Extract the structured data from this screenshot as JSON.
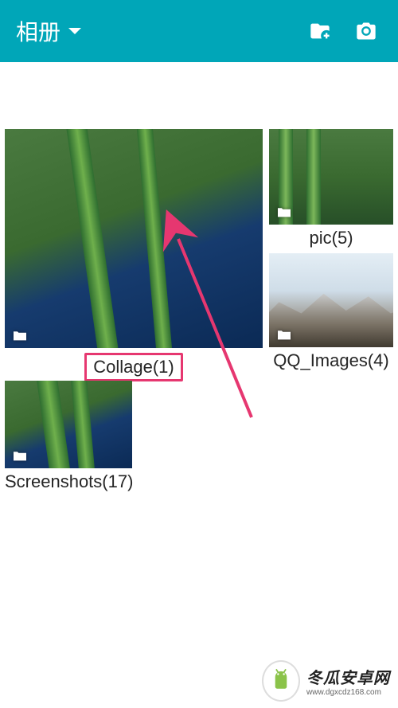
{
  "header": {
    "title": "相册",
    "actions": {
      "new_folder_icon": "new-folder",
      "camera_icon": "camera"
    }
  },
  "albums": {
    "collage": {
      "name": "Collage",
      "count": 1
    },
    "pic": {
      "name": "pic",
      "count": 5
    },
    "qq_images": {
      "name": "QQ_Images",
      "count": 4
    },
    "screenshots": {
      "name": "Screenshots",
      "count": 17
    }
  },
  "annotation": {
    "highlight_target": "collage",
    "highlight_color": "#e63770"
  },
  "watermark": {
    "text": "冬瓜安卓网",
    "url": "www.dgxcdz168.com"
  }
}
